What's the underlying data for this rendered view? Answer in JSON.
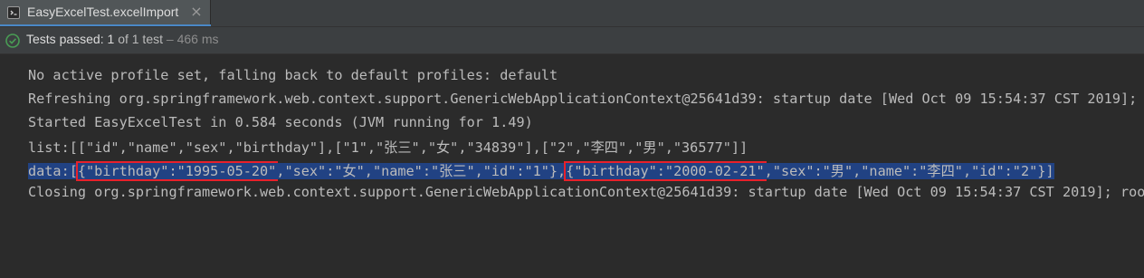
{
  "tab": {
    "title": "EasyExcelTest.excelImport",
    "close_glyph": "×",
    "icon": "test-class-icon"
  },
  "status": {
    "label": "Tests passed:",
    "count": "1",
    "of_text": "of 1 test",
    "duration": "– 466 ms",
    "icon": "check-circle-icon",
    "color": "#499c54"
  },
  "console": {
    "lines": [
      "No active profile set, falling back to default profiles: default",
      "Refreshing org.springframework.web.context.support.GenericWebApplicationContext@25641d39: startup date [Wed Oct 09 15:54:37 CST 2019]; root",
      "Started EasyExcelTest in 0.584 seconds (JVM running for 1.49)",
      "list:[[\"id\",\"name\",\"sex\",\"birthday\"],[\"1\",\"张三\",\"女\",\"34839\"],[\"2\",\"李四\",\"男\",\"36577\"]]",
      "Closing org.springframework.web.context.support.GenericWebApplicationContext@25641d39: startup date [Wed Oct 09 15:54:37 CST 2019]; root"
    ],
    "data_line": {
      "prefix": "data:[",
      "rec1_highlight": "{\"birthday\":\"1995-05-20\"",
      "rec1_rest": ",\"sex\":\"女\",\"name\":\"张三\",\"id\":\"1\"},",
      "rec2_highlight": "{\"birthday\":\"2000-02-21\"",
      "rec2_rest": ",\"sex\":\"男\",\"name\":\"李四\",\"id\":\"2\"}]"
    },
    "selection_color": "#214283",
    "highlight_color": "#e8202a"
  }
}
